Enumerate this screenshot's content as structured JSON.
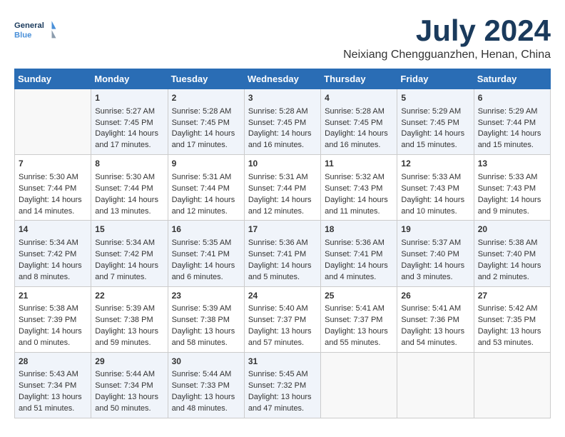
{
  "header": {
    "logo_line1": "General",
    "logo_line2": "Blue",
    "month_title": "July 2024",
    "location": "Neixiang Chengguanzhen, Henan, China"
  },
  "days_of_week": [
    "Sunday",
    "Monday",
    "Tuesday",
    "Wednesday",
    "Thursday",
    "Friday",
    "Saturday"
  ],
  "weeks": [
    [
      {
        "day": "",
        "content": ""
      },
      {
        "day": "1",
        "content": "Sunrise: 5:27 AM\nSunset: 7:45 PM\nDaylight: 14 hours\nand 17 minutes."
      },
      {
        "day": "2",
        "content": "Sunrise: 5:28 AM\nSunset: 7:45 PM\nDaylight: 14 hours\nand 17 minutes."
      },
      {
        "day": "3",
        "content": "Sunrise: 5:28 AM\nSunset: 7:45 PM\nDaylight: 14 hours\nand 16 minutes."
      },
      {
        "day": "4",
        "content": "Sunrise: 5:28 AM\nSunset: 7:45 PM\nDaylight: 14 hours\nand 16 minutes."
      },
      {
        "day": "5",
        "content": "Sunrise: 5:29 AM\nSunset: 7:45 PM\nDaylight: 14 hours\nand 15 minutes."
      },
      {
        "day": "6",
        "content": "Sunrise: 5:29 AM\nSunset: 7:44 PM\nDaylight: 14 hours\nand 15 minutes."
      }
    ],
    [
      {
        "day": "7",
        "content": "Sunrise: 5:30 AM\nSunset: 7:44 PM\nDaylight: 14 hours\nand 14 minutes."
      },
      {
        "day": "8",
        "content": "Sunrise: 5:30 AM\nSunset: 7:44 PM\nDaylight: 14 hours\nand 13 minutes."
      },
      {
        "day": "9",
        "content": "Sunrise: 5:31 AM\nSunset: 7:44 PM\nDaylight: 14 hours\nand 12 minutes."
      },
      {
        "day": "10",
        "content": "Sunrise: 5:31 AM\nSunset: 7:44 PM\nDaylight: 14 hours\nand 12 minutes."
      },
      {
        "day": "11",
        "content": "Sunrise: 5:32 AM\nSunset: 7:43 PM\nDaylight: 14 hours\nand 11 minutes."
      },
      {
        "day": "12",
        "content": "Sunrise: 5:33 AM\nSunset: 7:43 PM\nDaylight: 14 hours\nand 10 minutes."
      },
      {
        "day": "13",
        "content": "Sunrise: 5:33 AM\nSunset: 7:43 PM\nDaylight: 14 hours\nand 9 minutes."
      }
    ],
    [
      {
        "day": "14",
        "content": "Sunrise: 5:34 AM\nSunset: 7:42 PM\nDaylight: 14 hours\nand 8 minutes."
      },
      {
        "day": "15",
        "content": "Sunrise: 5:34 AM\nSunset: 7:42 PM\nDaylight: 14 hours\nand 7 minutes."
      },
      {
        "day": "16",
        "content": "Sunrise: 5:35 AM\nSunset: 7:41 PM\nDaylight: 14 hours\nand 6 minutes."
      },
      {
        "day": "17",
        "content": "Sunrise: 5:36 AM\nSunset: 7:41 PM\nDaylight: 14 hours\nand 5 minutes."
      },
      {
        "day": "18",
        "content": "Sunrise: 5:36 AM\nSunset: 7:41 PM\nDaylight: 14 hours\nand 4 minutes."
      },
      {
        "day": "19",
        "content": "Sunrise: 5:37 AM\nSunset: 7:40 PM\nDaylight: 14 hours\nand 3 minutes."
      },
      {
        "day": "20",
        "content": "Sunrise: 5:38 AM\nSunset: 7:40 PM\nDaylight: 14 hours\nand 2 minutes."
      }
    ],
    [
      {
        "day": "21",
        "content": "Sunrise: 5:38 AM\nSunset: 7:39 PM\nDaylight: 14 hours\nand 0 minutes."
      },
      {
        "day": "22",
        "content": "Sunrise: 5:39 AM\nSunset: 7:38 PM\nDaylight: 13 hours\nand 59 minutes."
      },
      {
        "day": "23",
        "content": "Sunrise: 5:39 AM\nSunset: 7:38 PM\nDaylight: 13 hours\nand 58 minutes."
      },
      {
        "day": "24",
        "content": "Sunrise: 5:40 AM\nSunset: 7:37 PM\nDaylight: 13 hours\nand 57 minutes."
      },
      {
        "day": "25",
        "content": "Sunrise: 5:41 AM\nSunset: 7:37 PM\nDaylight: 13 hours\nand 55 minutes."
      },
      {
        "day": "26",
        "content": "Sunrise: 5:41 AM\nSunset: 7:36 PM\nDaylight: 13 hours\nand 54 minutes."
      },
      {
        "day": "27",
        "content": "Sunrise: 5:42 AM\nSunset: 7:35 PM\nDaylight: 13 hours\nand 53 minutes."
      }
    ],
    [
      {
        "day": "28",
        "content": "Sunrise: 5:43 AM\nSunset: 7:34 PM\nDaylight: 13 hours\nand 51 minutes."
      },
      {
        "day": "29",
        "content": "Sunrise: 5:44 AM\nSunset: 7:34 PM\nDaylight: 13 hours\nand 50 minutes."
      },
      {
        "day": "30",
        "content": "Sunrise: 5:44 AM\nSunset: 7:33 PM\nDaylight: 13 hours\nand 48 minutes."
      },
      {
        "day": "31",
        "content": "Sunrise: 5:45 AM\nSunset: 7:32 PM\nDaylight: 13 hours\nand 47 minutes."
      },
      {
        "day": "",
        "content": ""
      },
      {
        "day": "",
        "content": ""
      },
      {
        "day": "",
        "content": ""
      }
    ]
  ]
}
